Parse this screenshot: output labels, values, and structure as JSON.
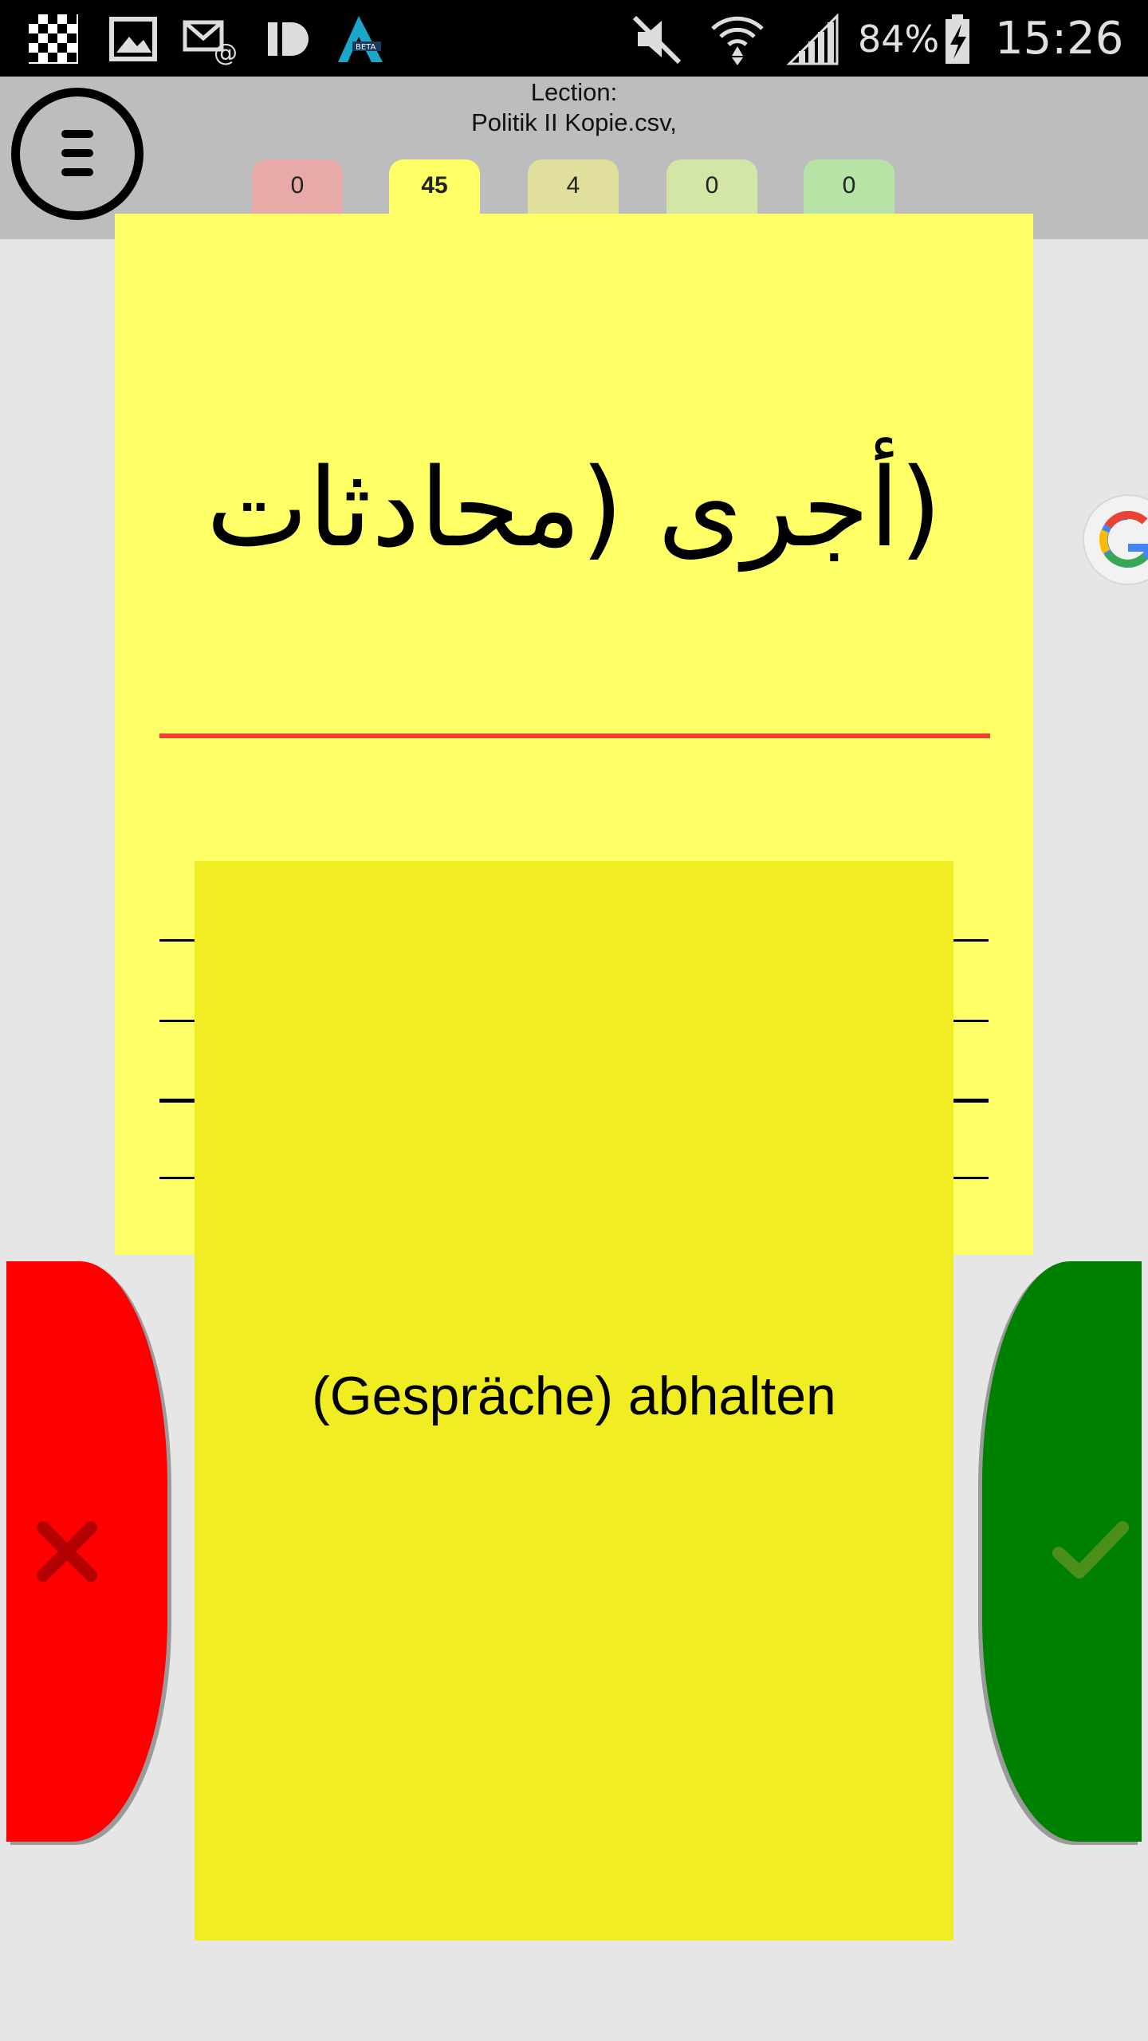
{
  "status_bar": {
    "battery": "84%",
    "time": "15:26",
    "icons": [
      "checkerboard-app-icon",
      "gallery-icon",
      "email-icon",
      "id-app-icon",
      "beta-app-icon",
      "mute-icon",
      "wifi-icon",
      "signal-icon",
      "battery-charging-icon"
    ],
    "beta_badge": "BETA"
  },
  "header": {
    "lection_label": "Lection:",
    "lection_file": "Politik II Kopie.csv,",
    "menu_icon": "hamburger-menu-icon",
    "tabs": [
      {
        "count": "0",
        "color": "#e8a9a9"
      },
      {
        "count": "45",
        "color": "#ffff66"
      },
      {
        "count": "4",
        "color": "#e0e09c"
      },
      {
        "count": "0",
        "color": "#d4e6a6"
      },
      {
        "count": "0",
        "color": "#b7e3a6"
      }
    ]
  },
  "card": {
    "question": "(أجرى (محادثات",
    "answer": "(Gespräche) abhalten",
    "card_color": "#ffff66",
    "answer_color": "#f0ee22",
    "divider_color": "#f0402f"
  },
  "actions": {
    "wrong_icon": "red-cross-icon",
    "right_icon": "green-checkmark-icon",
    "wrong_color": "#ff0000",
    "right_color": "#008000"
  },
  "side_widget": {
    "icon": "google-icon"
  }
}
